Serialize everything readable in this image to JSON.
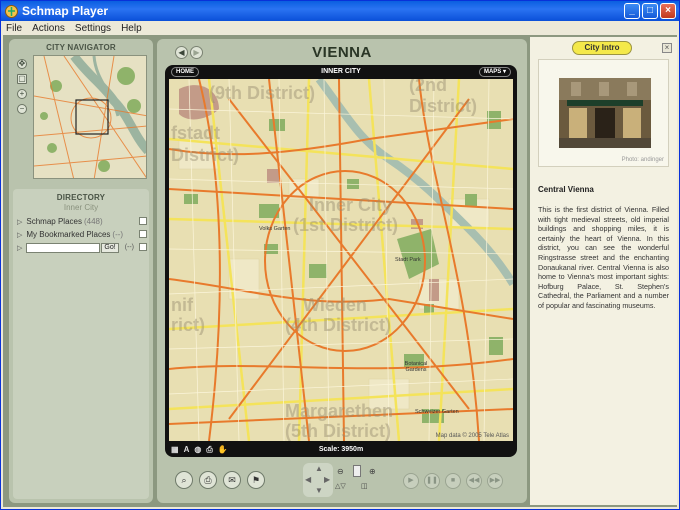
{
  "window": {
    "title": "Schmap Player"
  },
  "menu": [
    "File",
    "Actions",
    "Settings",
    "Help"
  ],
  "navigator": {
    "title": "CITY NAVIGATOR"
  },
  "directory": {
    "title": "DIRECTORY",
    "subtitle": "Inner City",
    "items": [
      {
        "label": "Schmap Places",
        "count": "(448)"
      },
      {
        "label": "My Bookmarked Places",
        "count": "(--)"
      }
    ],
    "search": {
      "value": "",
      "go_label": "Go!",
      "minus_label": "(--)"
    }
  },
  "center": {
    "city_title": "VIENNA",
    "map_header": "INNER CITY",
    "home_label": "HOME",
    "maps_label": "MAPS",
    "scale_label": "Scale: 3950m",
    "copyright": "Map data © 2005 Tele Atlas"
  },
  "map_labels": {
    "district9": "(9th District)",
    "district2": "(2nd District)",
    "josefstadt_a": "fstadt",
    "josefstadt_b": "District)",
    "inner_a": "Inner City",
    "inner_b": "(1st District)",
    "wieden_a": "Wieden",
    "wieden_b": "(4th District)",
    "margareten_a": "Margarethen",
    "margareten_b": "(5th District)",
    "nif_a": "nif",
    "nif_b": "rict)",
    "volksgarten": "Volks Garten",
    "stadtpark": "Stadt Park",
    "botanical": "Botanical Gardens",
    "schweizer": "Schweizer Garten"
  },
  "intro": {
    "tab_label": "City Intro",
    "close_label": "×",
    "photo_credit": "Photo: andinger",
    "heading": "Central Vienna",
    "text": "This is the first district of Vienna. Filled with tight medieval streets, old imperial buildings and shopping miles, it is certainly the heart of Vienna. In this district, you can see the wonderful Ringstrasse street and the enchanting Donaukanal river. Central Vienna is also home to Vienna's most important sights: Hofburg Palace, St. Stephen's Cathedral, the Parliament and a number of popular and fascinating museums."
  },
  "colors": {
    "accent": "#f4e94a",
    "map_bg": "#e8dfb2",
    "road": "#e87a2c",
    "park": "#8fb36a"
  }
}
